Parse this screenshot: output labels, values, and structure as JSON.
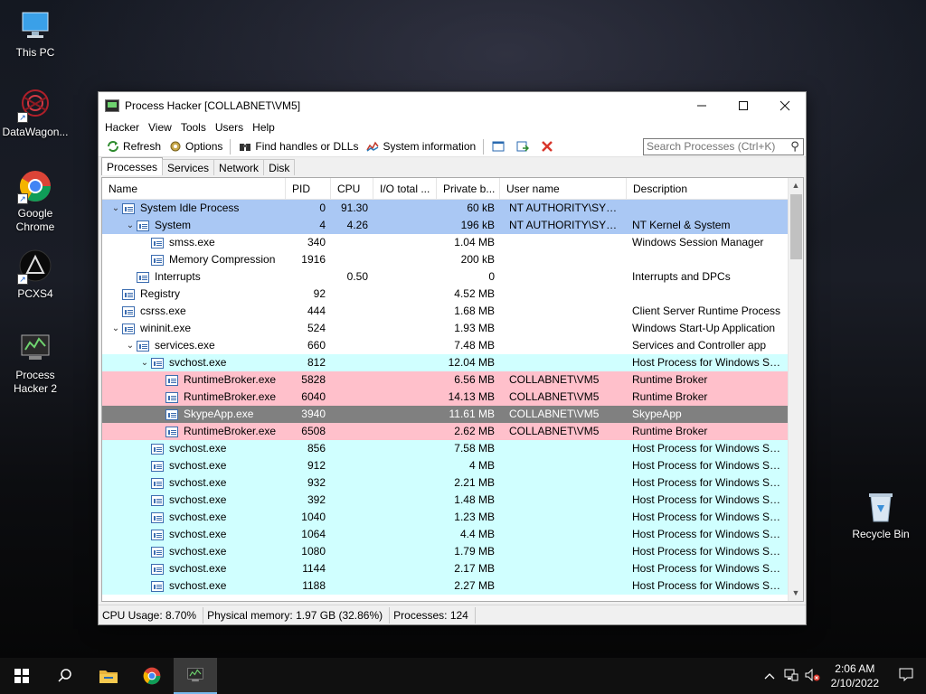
{
  "desktop": {
    "icons": [
      {
        "label": "This PC",
        "icon": "this-pc-icon"
      },
      {
        "label": "DataWagon...",
        "icon": "datawagon-icon"
      },
      {
        "label": "Google Chrome",
        "icon": "chrome-icon"
      },
      {
        "label": "PCXS4",
        "icon": "pcxs4-icon"
      },
      {
        "label": "Process Hacker 2",
        "icon": "process-hacker-icon"
      },
      {
        "label": "Recycle Bin",
        "icon": "recycle-bin-icon"
      }
    ]
  },
  "window": {
    "title": "Process Hacker [COLLABNET\\VM5]",
    "menu": [
      "Hacker",
      "View",
      "Tools",
      "Users",
      "Help"
    ],
    "toolbar": {
      "refresh": "Refresh",
      "options": "Options",
      "find_handles": "Find handles or DLLs",
      "system_info": "System information",
      "search_placeholder": "Search Processes (Ctrl+K)"
    },
    "tabs": [
      "Processes",
      "Services",
      "Network",
      "Disk"
    ],
    "active_tab": "Processes",
    "columns": [
      "Name",
      "PID",
      "CPU",
      "I/O total ...",
      "Private b...",
      "User name",
      "Description"
    ],
    "rows": [
      {
        "name": "System Idle Process",
        "pid": "0",
        "cpu": "91.30",
        "io": "",
        "priv": "60 kB",
        "user": "NT AUTHORITY\\SYSTEM",
        "desc": "",
        "depth": 0,
        "expander": "collapse",
        "highlight": "system"
      },
      {
        "name": "System",
        "pid": "4",
        "cpu": "4.26",
        "io": "",
        "priv": "196 kB",
        "user": "NT AUTHORITY\\SYSTEM",
        "desc": "NT Kernel & System",
        "depth": 1,
        "expander": "collapse",
        "highlight": "system"
      },
      {
        "name": "smss.exe",
        "pid": "340",
        "cpu": "",
        "io": "",
        "priv": "1.04 MB",
        "user": "",
        "desc": "Windows Session Manager",
        "depth": 2,
        "expander": "",
        "highlight": "none"
      },
      {
        "name": "Memory Compression",
        "pid": "1916",
        "cpu": "",
        "io": "",
        "priv": "200 kB",
        "user": "",
        "desc": "",
        "depth": 2,
        "expander": "",
        "highlight": "none"
      },
      {
        "name": "Interrupts",
        "pid": "",
        "cpu": "0.50",
        "io": "",
        "priv": "0",
        "user": "",
        "desc": "Interrupts and DPCs",
        "depth": 1,
        "expander": "",
        "highlight": "none"
      },
      {
        "name": "Registry",
        "pid": "92",
        "cpu": "",
        "io": "",
        "priv": "4.52 MB",
        "user": "",
        "desc": "",
        "depth": 0,
        "expander": "",
        "highlight": "none"
      },
      {
        "name": "csrss.exe",
        "pid": "444",
        "cpu": "",
        "io": "",
        "priv": "1.68 MB",
        "user": "",
        "desc": "Client Server Runtime Process",
        "depth": 0,
        "expander": "",
        "highlight": "none"
      },
      {
        "name": "wininit.exe",
        "pid": "524",
        "cpu": "",
        "io": "",
        "priv": "1.93 MB",
        "user": "",
        "desc": "Windows Start-Up Application",
        "depth": 0,
        "expander": "collapse",
        "highlight": "none"
      },
      {
        "name": "services.exe",
        "pid": "660",
        "cpu": "",
        "io": "",
        "priv": "7.48 MB",
        "user": "",
        "desc": "Services and Controller app",
        "depth": 1,
        "expander": "collapse",
        "highlight": "none"
      },
      {
        "name": "svchost.exe",
        "pid": "812",
        "cpu": "",
        "io": "",
        "priv": "12.04 MB",
        "user": "",
        "desc": "Host Process for Windows Ser...",
        "depth": 2,
        "expander": "collapse",
        "highlight": "service"
      },
      {
        "name": "RuntimeBroker.exe",
        "pid": "5828",
        "cpu": "",
        "io": "",
        "priv": "6.56 MB",
        "user": "COLLABNET\\VM5",
        "desc": "Runtime Broker",
        "depth": 3,
        "expander": "",
        "highlight": "user"
      },
      {
        "name": "RuntimeBroker.exe",
        "pid": "6040",
        "cpu": "",
        "io": "",
        "priv": "14.13 MB",
        "user": "COLLABNET\\VM5",
        "desc": "Runtime Broker",
        "depth": 3,
        "expander": "",
        "highlight": "user"
      },
      {
        "name": "SkypeApp.exe",
        "pid": "3940",
        "cpu": "",
        "io": "",
        "priv": "11.61 MB",
        "user": "COLLABNET\\VM5",
        "desc": "SkypeApp",
        "depth": 3,
        "expander": "",
        "highlight": "suspended"
      },
      {
        "name": "RuntimeBroker.exe",
        "pid": "6508",
        "cpu": "",
        "io": "",
        "priv": "2.62 MB",
        "user": "COLLABNET\\VM5",
        "desc": "Runtime Broker",
        "depth": 3,
        "expander": "",
        "highlight": "user"
      },
      {
        "name": "svchost.exe",
        "pid": "856",
        "cpu": "",
        "io": "",
        "priv": "7.58 MB",
        "user": "",
        "desc": "Host Process for Windows Ser...",
        "depth": 2,
        "expander": "",
        "highlight": "service"
      },
      {
        "name": "svchost.exe",
        "pid": "912",
        "cpu": "",
        "io": "",
        "priv": "4 MB",
        "user": "",
        "desc": "Host Process for Windows Ser...",
        "depth": 2,
        "expander": "",
        "highlight": "service"
      },
      {
        "name": "svchost.exe",
        "pid": "932",
        "cpu": "",
        "io": "",
        "priv": "2.21 MB",
        "user": "",
        "desc": "Host Process for Windows Ser...",
        "depth": 2,
        "expander": "",
        "highlight": "service"
      },
      {
        "name": "svchost.exe",
        "pid": "392",
        "cpu": "",
        "io": "",
        "priv": "1.48 MB",
        "user": "",
        "desc": "Host Process for Windows Ser...",
        "depth": 2,
        "expander": "",
        "highlight": "service"
      },
      {
        "name": "svchost.exe",
        "pid": "1040",
        "cpu": "",
        "io": "",
        "priv": "1.23 MB",
        "user": "",
        "desc": "Host Process for Windows Ser...",
        "depth": 2,
        "expander": "",
        "highlight": "service"
      },
      {
        "name": "svchost.exe",
        "pid": "1064",
        "cpu": "",
        "io": "",
        "priv": "4.4 MB",
        "user": "",
        "desc": "Host Process for Windows Ser...",
        "depth": 2,
        "expander": "",
        "highlight": "service"
      },
      {
        "name": "svchost.exe",
        "pid": "1080",
        "cpu": "",
        "io": "",
        "priv": "1.79 MB",
        "user": "",
        "desc": "Host Process for Windows Ser...",
        "depth": 2,
        "expander": "",
        "highlight": "service"
      },
      {
        "name": "svchost.exe",
        "pid": "1144",
        "cpu": "",
        "io": "",
        "priv": "2.17 MB",
        "user": "",
        "desc": "Host Process for Windows Ser...",
        "depth": 2,
        "expander": "",
        "highlight": "service"
      },
      {
        "name": "svchost.exe",
        "pid": "1188",
        "cpu": "",
        "io": "",
        "priv": "2.27 MB",
        "user": "",
        "desc": "Host Process for Windows Ser...",
        "depth": 2,
        "expander": "",
        "highlight": "service"
      }
    ],
    "status": {
      "cpu": "CPU Usage: 8.70%",
      "memory": "Physical memory: 1.97 GB (32.86%)",
      "processes": "Processes: 124"
    }
  },
  "colors": {
    "system": "#aac8f4",
    "service": "#d0ffff",
    "user": "#ffc0cb",
    "suspended": "#808080",
    "none": "#ffffff"
  },
  "taskbar": {
    "time": "2:06 AM",
    "date": "2/10/2022",
    "buttons": [
      "start-icon",
      "search-icon",
      "file-explorer-icon",
      "chrome-icon",
      "process-hacker-icon"
    ]
  }
}
